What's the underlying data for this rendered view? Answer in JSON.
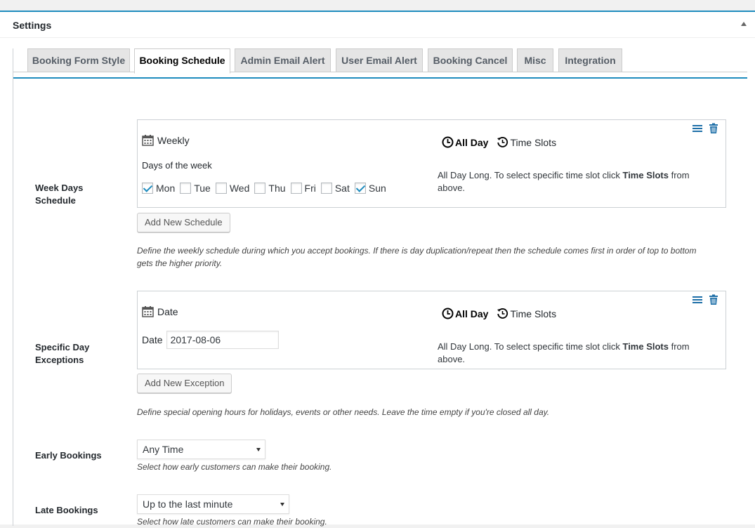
{
  "panel": {
    "title": "Settings"
  },
  "tabs": [
    {
      "label": "Booking Form Style"
    },
    {
      "label": "Booking Schedule"
    },
    {
      "label": "Admin Email Alert"
    },
    {
      "label": "User Email Alert"
    },
    {
      "label": "Booking Cancel"
    },
    {
      "label": "Misc"
    },
    {
      "label": "Integration"
    }
  ],
  "week_schedule": {
    "row_label_1": "Week Days",
    "row_label_2": "Schedule",
    "frequency": "Weekly",
    "days_label": "Days of the week",
    "days": [
      {
        "label": "Mon",
        "checked": true
      },
      {
        "label": "Tue",
        "checked": false
      },
      {
        "label": "Wed",
        "checked": false
      },
      {
        "label": "Thu",
        "checked": false
      },
      {
        "label": "Fri",
        "checked": false
      },
      {
        "label": "Sat",
        "checked": false
      },
      {
        "label": "Sun",
        "checked": true
      }
    ],
    "all_day": "All Day",
    "time_slots": "Time Slots",
    "desc_prefix": "All Day Long. To select specific time slot click ",
    "desc_bold": "Time Slots",
    "desc_suffix": " from above.",
    "add_button": "Add New Schedule",
    "help": "Define the weekly schedule during which you accept bookings. If there is day duplication/repeat then the schedule comes first in order of top to bottom gets the higher priority."
  },
  "exceptions": {
    "row_label_1": "Specific Day",
    "row_label_2": "Exceptions",
    "type": "Date",
    "date_label": "Date",
    "date_value": "2017-08-06",
    "all_day": "All Day",
    "time_slots": "Time Slots",
    "desc_prefix": "All Day Long. To select specific time slot click ",
    "desc_bold": "Time Slots",
    "desc_suffix": " from above.",
    "add_button": "Add New Exception",
    "help": "Define special opening hours for holidays, events or other needs. Leave the time empty if you're closed all day."
  },
  "early": {
    "label": "Early Bookings",
    "value": "Any Time",
    "help": "Select how early customers can make their booking."
  },
  "late": {
    "label": "Late Bookings",
    "value": "Up to the last minute",
    "help": "Select how late customers can make their booking."
  },
  "colors": {
    "accent": "#1e8cbe",
    "tab_bg": "#e5e5e5"
  },
  "icons": [
    "calendar-icon",
    "clock-icon",
    "history-icon",
    "menu-icon",
    "trash-icon",
    "collapse-arrow-icon"
  ]
}
